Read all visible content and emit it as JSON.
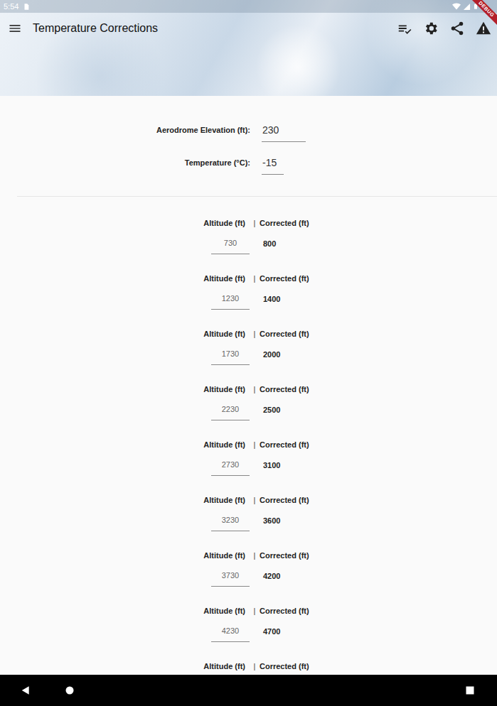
{
  "status_bar": {
    "time": "5:54"
  },
  "debug_banner": "DEBUG",
  "app_bar": {
    "title": "Temperature Corrections"
  },
  "fields": [
    {
      "label": "Aerodrome Elevation (ft):",
      "value": "230"
    },
    {
      "label": "Temperature (°C):",
      "value": "-15"
    }
  ],
  "corrections": {
    "rows": [
      {
        "altitude_label": "Altitude (ft)",
        "separator": "|",
        "corrected_label": "Corrected (ft)",
        "altitude": "730",
        "corrected": "800"
      },
      {
        "altitude_label": "Altitude (ft)",
        "separator": "|",
        "corrected_label": "Corrected (ft)",
        "altitude": "1230",
        "corrected": "1400"
      },
      {
        "altitude_label": "Altitude (ft)",
        "separator": "|",
        "corrected_label": "Corrected (ft)",
        "altitude": "1730",
        "corrected": "2000"
      },
      {
        "altitude_label": "Altitude (ft)",
        "separator": "|",
        "corrected_label": "Corrected (ft)",
        "altitude": "2230",
        "corrected": "2500"
      },
      {
        "altitude_label": "Altitude (ft)",
        "separator": "|",
        "corrected_label": "Corrected (ft)",
        "altitude": "2730",
        "corrected": "3100"
      },
      {
        "altitude_label": "Altitude (ft)",
        "separator": "|",
        "corrected_label": "Corrected (ft)",
        "altitude": "3230",
        "corrected": "3600"
      },
      {
        "altitude_label": "Altitude (ft)",
        "separator": "|",
        "corrected_label": "Corrected (ft)",
        "altitude": "3730",
        "corrected": "4200"
      },
      {
        "altitude_label": "Altitude (ft)",
        "separator": "|",
        "corrected_label": "Corrected (ft)",
        "altitude": "4230",
        "corrected": "4700"
      },
      {
        "altitude_label": "Altitude (ft)",
        "separator": "|",
        "corrected_label": "Corrected (ft)"
      }
    ]
  }
}
